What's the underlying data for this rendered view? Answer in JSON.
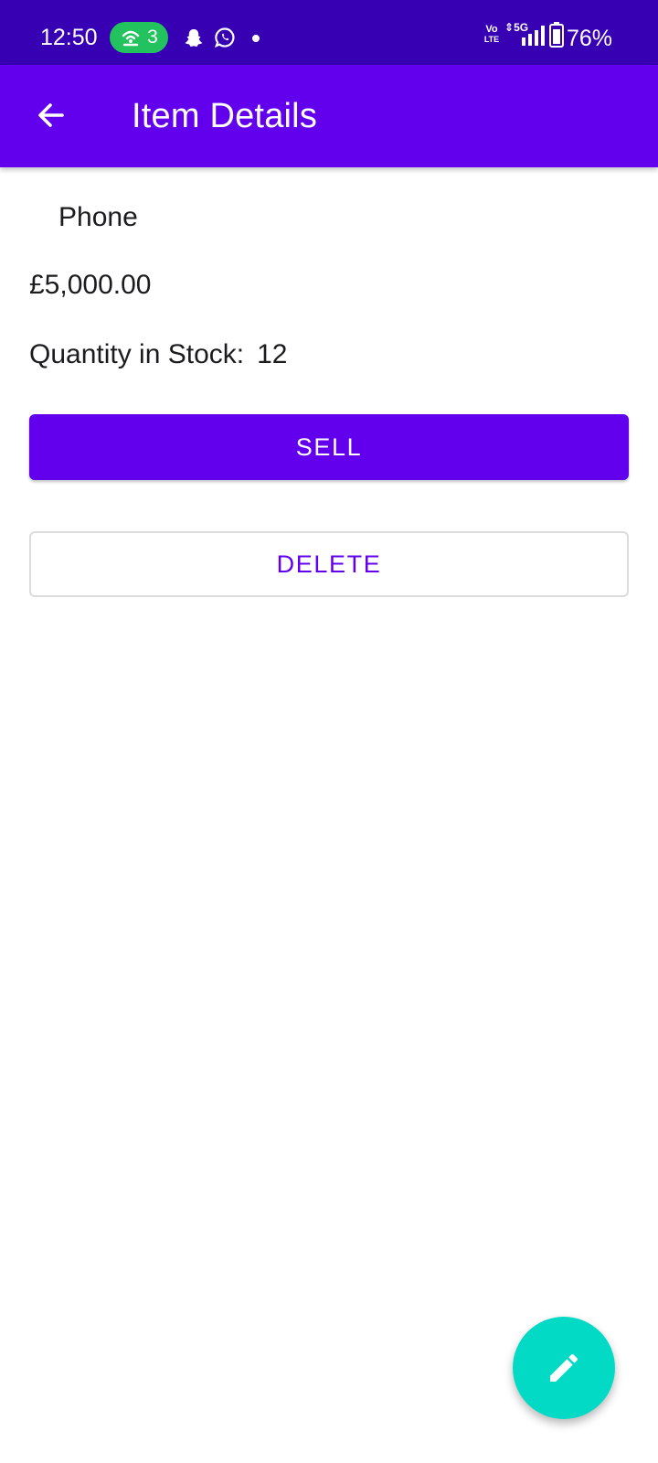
{
  "status_bar": {
    "time": "12:50",
    "hotspot_count": "3",
    "volte_top": "Vo",
    "volte_bottom": "LTE",
    "network": "5G",
    "battery": "76%",
    "icons": [
      "hotspot-icon",
      "snapchat-icon",
      "whatsapp-icon",
      "notification-dot",
      "signal-icon",
      "battery-icon"
    ]
  },
  "app_bar": {
    "title": "Item Details",
    "back_icon": "arrow-back-icon",
    "background": "#6200ee"
  },
  "item": {
    "name": "Phone",
    "price": "£5,000.00",
    "stock_label": "Quantity in Stock:",
    "stock_value": "12"
  },
  "actions": {
    "sell_label": "SELL",
    "delete_label": "DELETE",
    "edit_icon": "edit-pencil-icon"
  },
  "colors": {
    "status_bar": "#3700b3",
    "primary": "#6200ee",
    "fab": "#03dac5",
    "hotspot_badge": "#22c35e"
  }
}
